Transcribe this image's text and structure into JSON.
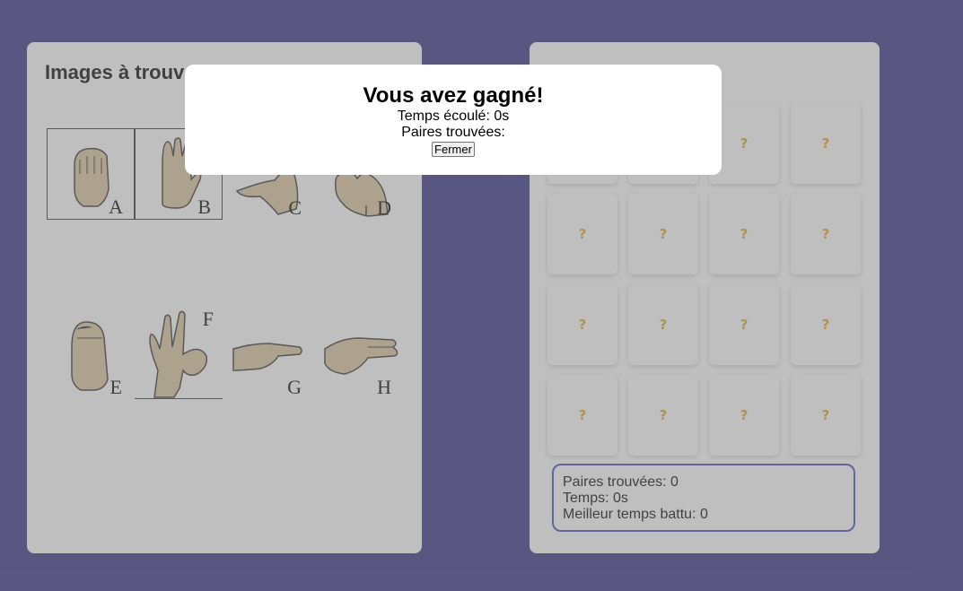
{
  "left_panel": {
    "title": "Images à trouver",
    "signs": [
      {
        "letter": "A"
      },
      {
        "letter": "B"
      },
      {
        "letter": "C"
      },
      {
        "letter": "D"
      },
      {
        "letter": "E"
      },
      {
        "letter": "F"
      },
      {
        "letter": "G"
      },
      {
        "letter": "H"
      }
    ]
  },
  "board": {
    "card_symbol": "?",
    "card_icon": "question-mark-icon",
    "card_color": "#e2a21d"
  },
  "stats": {
    "pairs": "Paires trouvées: 0",
    "time": "Temps: 0s",
    "best": "Meilleur temps battu: 0"
  },
  "dialog": {
    "title": "Vous avez gagné!",
    "time_line": "Temps écoulé: 0s",
    "pairs_line": "Paires trouvées:",
    "close_label": "Fermer"
  },
  "colors": {
    "background": "#332f84",
    "accent_border": "#4a47b9"
  }
}
